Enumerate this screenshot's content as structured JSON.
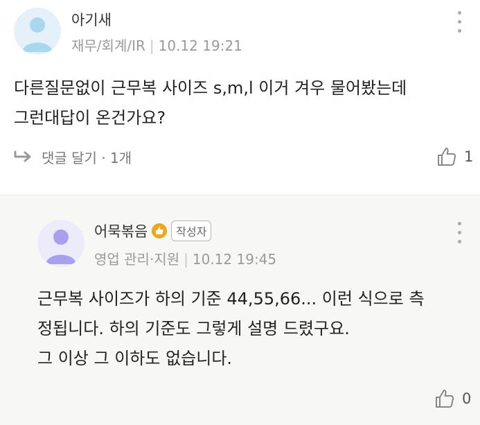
{
  "comment": {
    "author": "아기새",
    "department": "재무/회계/IR",
    "timestamp": "10.12 19:21",
    "text": "다른질문없이 근무복 사이즈 s,m,l  이거 겨우 물어봤는데\n그런대답이 온건가요?",
    "reply_label": "댓글 달기 · 1개",
    "like_count": "1",
    "avatar_color": "#a8d8f0"
  },
  "reply": {
    "author": "어묵볶음",
    "author_badge": "작성자",
    "department": "영업 관리·지원",
    "timestamp": "10.12 19:45",
    "text": "근무복 사이즈가 하의 기준 44,55,66... 이런 식으로 측\n정됩니다. 하의 기준도 그렇게 설명 드렸구요.\n그 이상 그 이하도 없습니다.",
    "like_count": "0",
    "avatar_color": "#b5aef0"
  }
}
